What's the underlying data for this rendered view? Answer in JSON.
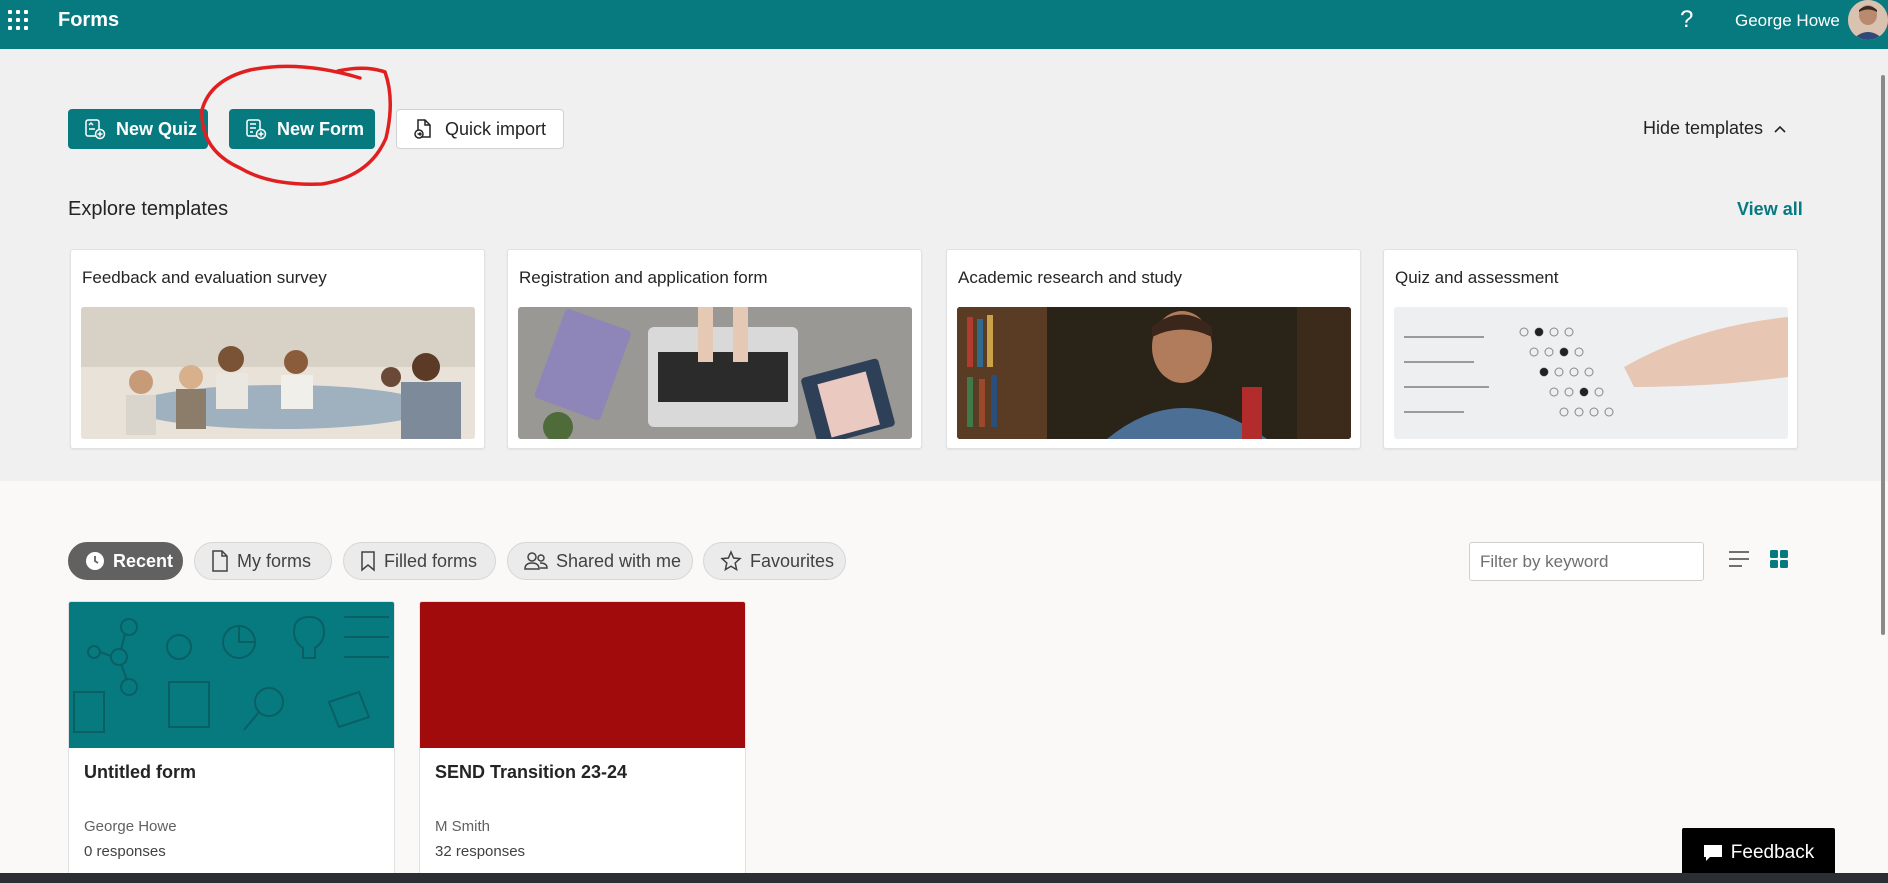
{
  "header": {
    "app_name": "Forms",
    "help_label": "?",
    "user_name": "George Howe"
  },
  "actions": {
    "new_quiz": "New Quiz",
    "new_form": "New Form",
    "quick_import": "Quick import",
    "hide_templates": "Hide templates"
  },
  "templates": {
    "title": "Explore templates",
    "view_all": "View all",
    "items": [
      {
        "title": "Feedback and evaluation survey"
      },
      {
        "title": "Registration and application form"
      },
      {
        "title": "Academic research and study"
      },
      {
        "title": "Quiz and assessment"
      }
    ]
  },
  "tabs": [
    {
      "label": "Recent",
      "active": true
    },
    {
      "label": "My forms"
    },
    {
      "label": "Filled forms"
    },
    {
      "label": "Shared with me"
    },
    {
      "label": "Favourites"
    }
  ],
  "filter": {
    "placeholder": "Filter by keyword"
  },
  "forms": [
    {
      "name": "Untitled form",
      "owner": "George Howe",
      "responses": "0 responses",
      "color": "#077a80"
    },
    {
      "name": "SEND Transition 23-24",
      "owner": "M Smith",
      "responses": "32 responses",
      "color": "#a20b0b"
    }
  ],
  "feedback": {
    "label": "Feedback"
  },
  "colors": {
    "brand": "#077a80",
    "annotation": "#e02020"
  }
}
